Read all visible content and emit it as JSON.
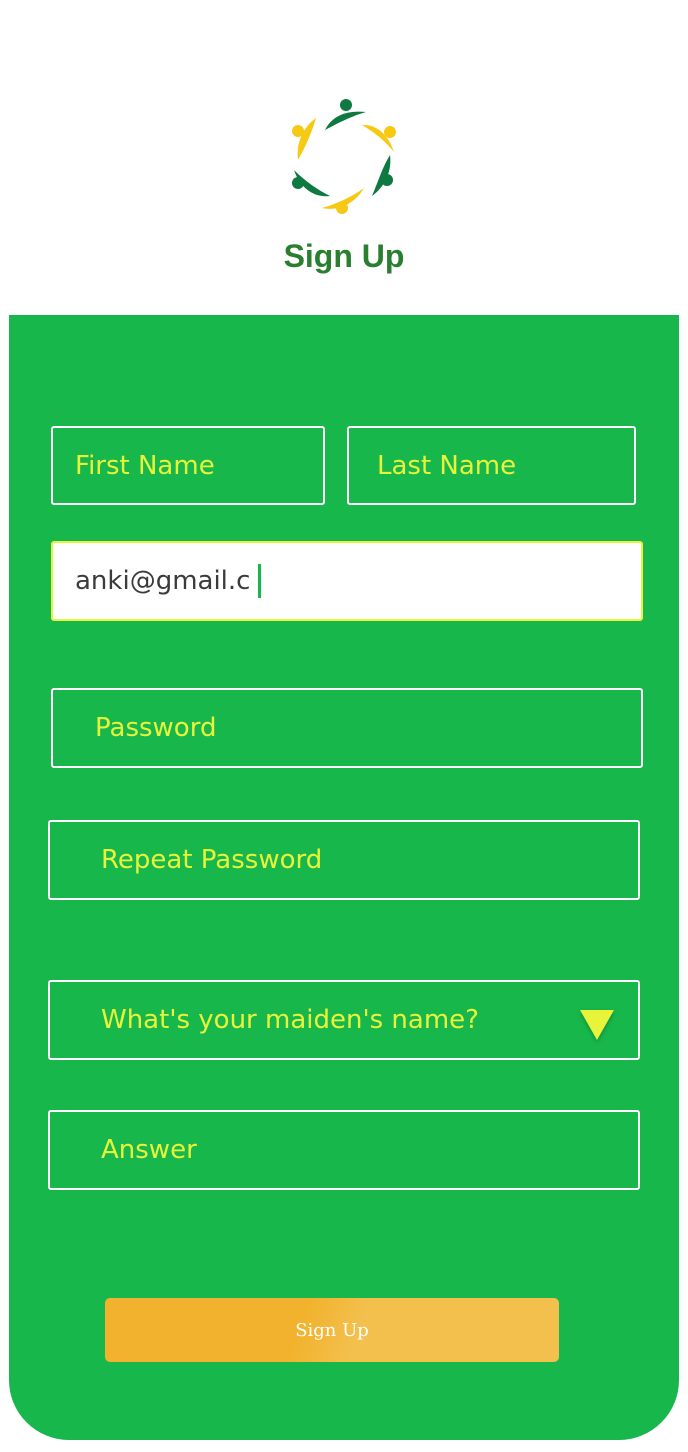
{
  "header": {
    "title": "Sign Up",
    "logo_icon": "people-circle-logo-icon"
  },
  "form": {
    "first_name_placeholder": "First Name",
    "last_name_placeholder": "Last Name",
    "email_value": "anki@gmail.c",
    "password_placeholder": "Password",
    "repeat_password_placeholder": "Repeat Password",
    "security_question": "What's your maiden's name?",
    "answer_placeholder": "Answer",
    "submit_label": "Sign Up"
  },
  "colors": {
    "panel": "#18b74b",
    "title": "#2a7e2f",
    "placeholder": "#e7f43a",
    "button": "#f2b22d",
    "logo_green": "#0e7a41",
    "logo_yellow": "#f6c915"
  }
}
